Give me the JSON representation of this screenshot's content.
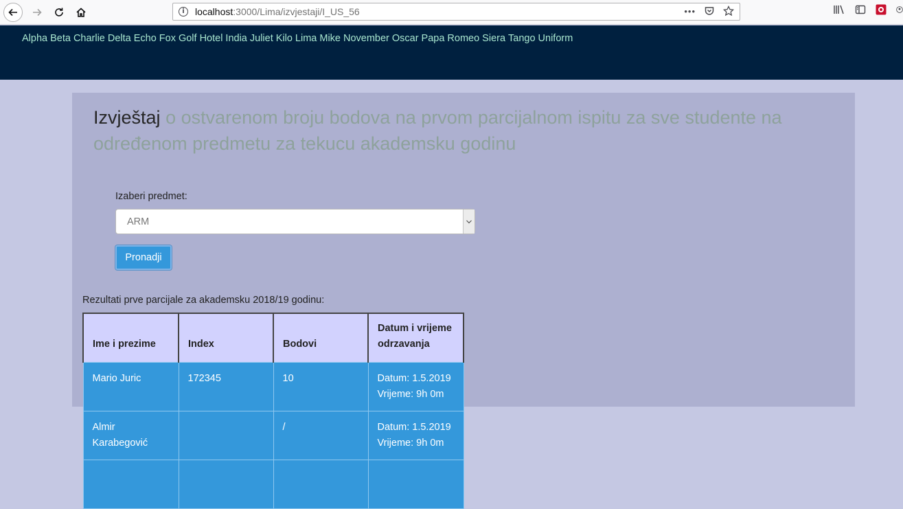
{
  "browser": {
    "url_host": "localhost",
    "url_path": ":3000/Lima/izvjestaji/I_US_56",
    "url_actions_more": "•••"
  },
  "nav": {
    "items": [
      "Alpha",
      "Beta",
      "Charlie",
      "Delta",
      "Echo",
      "Fox",
      "Golf",
      "Hotel",
      "India",
      "Juliet",
      "Kilo",
      "Lima",
      "Mike",
      "November",
      "Oscar",
      "Papa",
      "Romeo",
      "Siera",
      "Tango",
      "Uniform"
    ]
  },
  "page": {
    "title": "Izvještaj",
    "subtitle": "o ostvarenom broju bodova na prvom parcijalnom ispitu za sve studente na određenom predmetu za tekucu akademsku godinu",
    "select_label": "Izaberi predmet:",
    "select_value": "ARM",
    "find_button": "Pronadji",
    "results_caption": "Rezultati prve parcijale za akademsku 2018/19 godinu:"
  },
  "table": {
    "headers": [
      "Ime i prezime",
      "Index",
      "Bodovi",
      "Datum i vrijeme odrzavanja"
    ],
    "rows": [
      {
        "name": "Mario Juric",
        "index": "172345",
        "points": "10",
        "date": "Datum: 1.5.2019",
        "time": "Vrijeme: 9h 0m"
      },
      {
        "name": "Almir Karabegović",
        "index": "",
        "points": "/",
        "date": "Datum: 1.5.2019",
        "time": "Vrijeme: 9h 0m"
      },
      {
        "name": "",
        "index": "",
        "points": "",
        "date": "",
        "time": ""
      }
    ]
  },
  "colors": {
    "header_bg": "#00203f",
    "nav_link": "#a8e6cf",
    "panel_bg": "#adb0d0",
    "page_bg": "#c5c8e3",
    "button_bg": "#3498db",
    "table_header_bg": "#d2d2fe",
    "table_row_bg": "#3498db"
  }
}
